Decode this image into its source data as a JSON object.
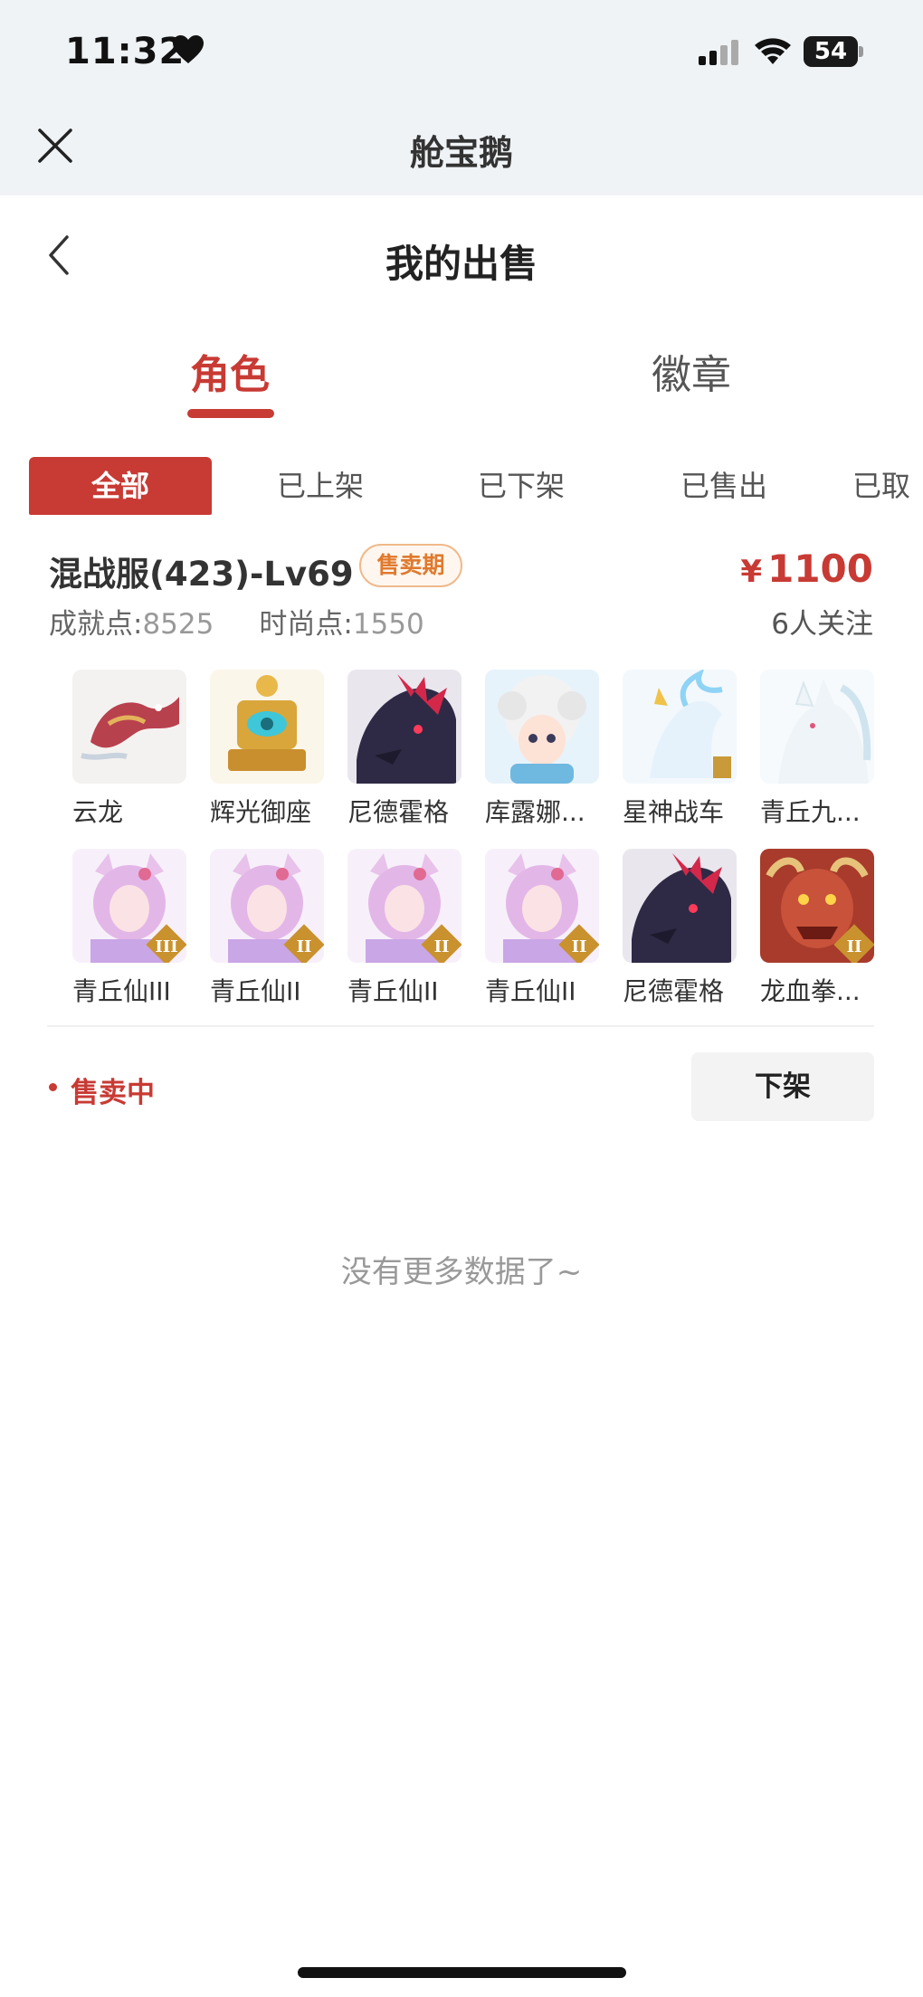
{
  "status_bar": {
    "time": "11:32",
    "battery": "54"
  },
  "app_bar": {
    "title": "舱宝鹅"
  },
  "page": {
    "title": "我的出售"
  },
  "main_tabs": [
    {
      "label": "角色"
    },
    {
      "label": "徽章"
    }
  ],
  "filter_chips": [
    {
      "label": "全部"
    },
    {
      "label": "已上架"
    },
    {
      "label": "已下架"
    },
    {
      "label": "已售出"
    },
    {
      "label": "已取消"
    }
  ],
  "listing": {
    "name": "混战服(423)-Lv69",
    "badge": "售卖期",
    "price_symbol": "¥",
    "price": "1100",
    "achievement_label": "成就点:",
    "achievement_value": "8525",
    "fashion_label": "时尚点:",
    "fashion_value": "1550",
    "followers": "6人关注",
    "items": [
      {
        "label": "云龙",
        "icon": "cloud-dragon"
      },
      {
        "label": "辉光御座",
        "icon": "radiant-throne"
      },
      {
        "label": "尼德霍格",
        "icon": "nidhogg-dragon"
      },
      {
        "label": "库露娜...",
        "icon": "kuluna-character"
      },
      {
        "label": "星神战车",
        "icon": "star-chariot"
      },
      {
        "label": "青丘九...",
        "icon": "white-fox"
      },
      {
        "label": "青丘仙III",
        "icon": "fox-fairy",
        "tier": "III"
      },
      {
        "label": "青丘仙II",
        "icon": "fox-fairy",
        "tier": "II"
      },
      {
        "label": "青丘仙II",
        "icon": "fox-fairy",
        "tier": "II"
      },
      {
        "label": "青丘仙II",
        "icon": "fox-fairy",
        "tier": "II"
      },
      {
        "label": "尼德霍格",
        "icon": "nidhogg-dragon"
      },
      {
        "label": "龙血拳...",
        "icon": "red-beast",
        "tier": "II"
      }
    ],
    "status": "售卖中",
    "action_button": "下架"
  },
  "footer": {
    "no_more": "没有更多数据了~"
  },
  "colors": {
    "accent": "#c83a34",
    "badge_orange": "#e07a2e",
    "topbar_bg": "#eff3f6"
  }
}
